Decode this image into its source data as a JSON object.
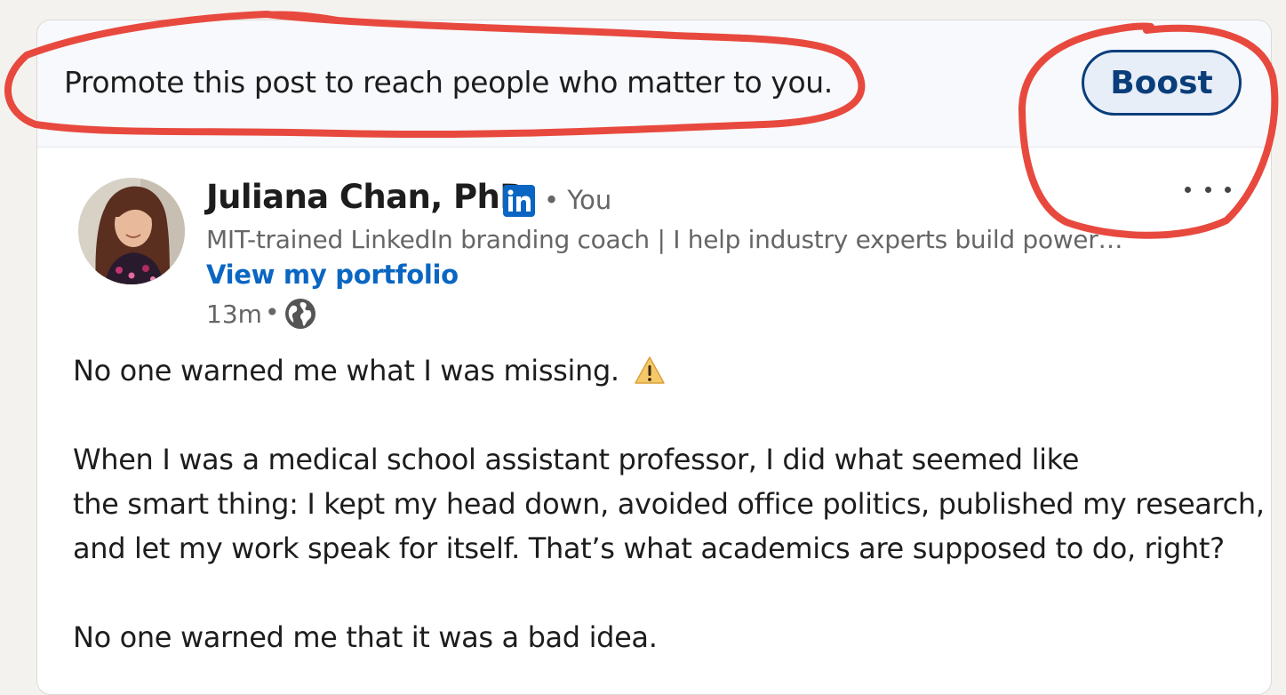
{
  "promo": {
    "text": "Promote this post to reach people who matter to you.",
    "boost_label": "Boost"
  },
  "author": {
    "name": "Juliana Chan, PhD",
    "badge_icon": "linkedin-icon",
    "relation": "• You",
    "headline": "MIT-trained LinkedIn branding coach | I help industry experts build powerful personal brands",
    "portfolio_link": "View my portfolio",
    "time": "13m",
    "visibility_icon": "globe-icon"
  },
  "post": {
    "lines": [
      "No one warned me what I was missing.",
      "When I was a medical school assistant professor, I did what seemed like",
      "the smart thing: I kept my head down, avoided office politics, published my research,",
      "and let my work speak for itself. That’s what academics are supposed to do, right?",
      "No one warned me that it was a bad idea."
    ],
    "warning_icon": "warning-icon"
  },
  "colors": {
    "accent": "#0a66c2",
    "boost_border": "#0a3e7a",
    "annotation": "#e8493e",
    "linkedin_blue": "#0a66c2"
  }
}
